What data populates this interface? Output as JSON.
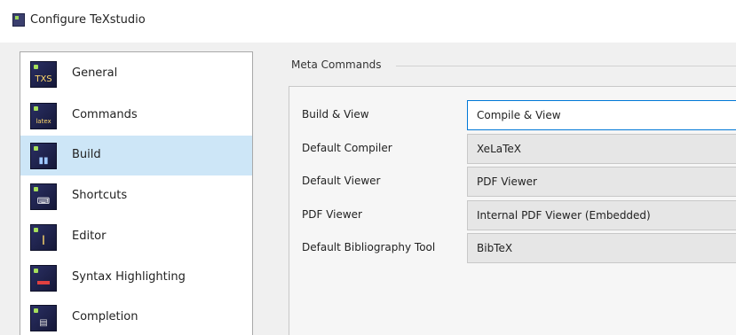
{
  "window": {
    "title": "Configure TeXstudio",
    "icon": "texstudio-app-icon"
  },
  "sidebar": {
    "selected_index": 2,
    "items": [
      {
        "label": "General",
        "icon": "general-icon",
        "glyph": "TXS"
      },
      {
        "label": "Commands",
        "icon": "commands-icon",
        "glyph": "latex"
      },
      {
        "label": "Build",
        "icon": "build-icon",
        "glyph": "▮▮"
      },
      {
        "label": "Shortcuts",
        "icon": "shortcuts-icon",
        "glyph": "⌨"
      },
      {
        "label": "Editor",
        "icon": "editor-icon",
        "glyph": "I"
      },
      {
        "label": "Syntax Highlighting",
        "icon": "syntax-highlighting-icon",
        "glyph": ""
      },
      {
        "label": "Completion",
        "icon": "completion-icon",
        "glyph": "▤"
      }
    ]
  },
  "meta_commands": {
    "group_title": "Meta Commands",
    "rows": [
      {
        "label": "Build & View",
        "value": "Compile & View"
      },
      {
        "label": "Default Compiler",
        "value": "XeLaTeX"
      },
      {
        "label": "Default Viewer",
        "value": "PDF Viewer"
      },
      {
        "label": "PDF Viewer",
        "value": "Internal PDF Viewer (Embedded)"
      },
      {
        "label": "Default Bibliography Tool",
        "value": "BibTeX"
      }
    ]
  },
  "colors": {
    "selection": "#cde6f7",
    "focus_border": "#0078d7",
    "icon_background": "#2a2f63",
    "icon_accent": "#a6e05c"
  }
}
